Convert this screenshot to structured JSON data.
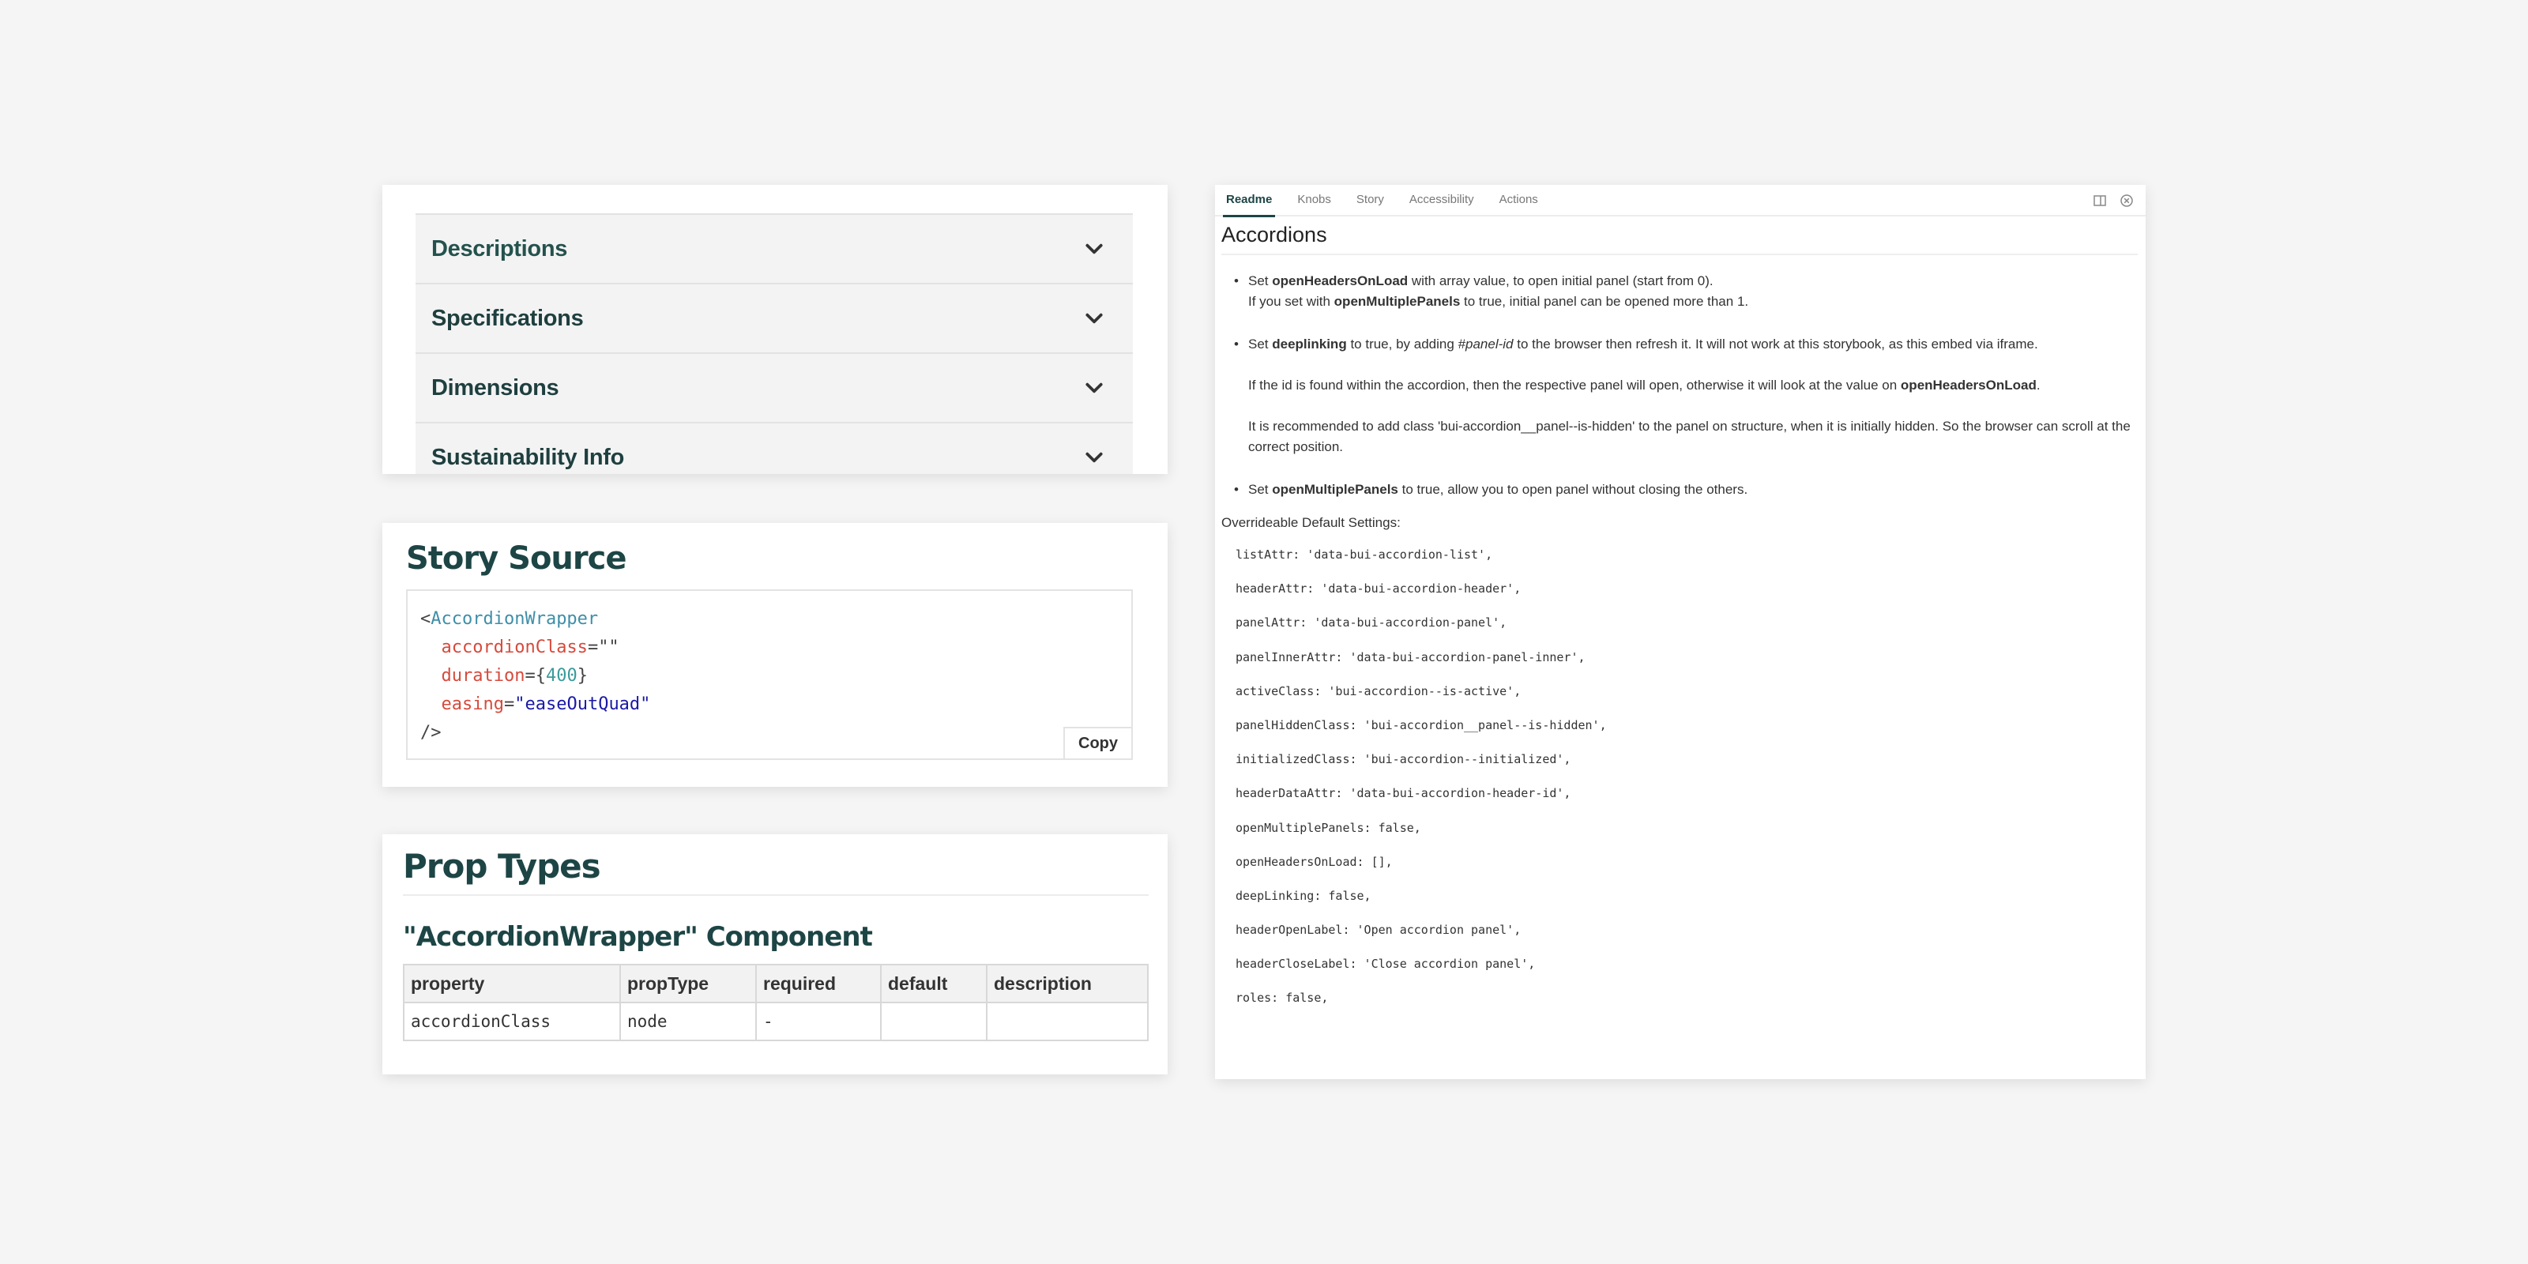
{
  "accordion": {
    "items": [
      {
        "title": "Descriptions"
      },
      {
        "title": "Specifications"
      },
      {
        "title": "Dimensions"
      },
      {
        "title": "Sustainability Info"
      }
    ]
  },
  "story_source": {
    "title": "Story Source",
    "code": {
      "open": "<",
      "tag": "AccordionWrapper",
      "attr1_name": "accordionClass",
      "attr1_eq": "=",
      "attr1_value": "\"\"",
      "attr2_name": "duration",
      "attr2_open": "={",
      "attr2_value": "400",
      "attr2_close": "}",
      "attr3_name": "easing",
      "attr3_eq": "=",
      "attr3_value": "\"easeOutQuad\"",
      "close": "/>"
    },
    "copy_label": "Copy"
  },
  "prop_types": {
    "title": "Prop Types",
    "component_title": "\"AccordionWrapper\" Component",
    "headers": [
      "property",
      "propType",
      "required",
      "default",
      "description"
    ],
    "rows": [
      [
        "accordionClass",
        "node",
        "-",
        "",
        ""
      ]
    ]
  },
  "readme": {
    "tabs": [
      "Readme",
      "Knobs",
      "Story",
      "Accessibility",
      "Actions"
    ],
    "heading": "Accordions",
    "b1_pre": "Set ",
    "b1_strong": "openHeadersOnLoad",
    "b1_post": " with array value, to open initial panel (start from 0).",
    "b1_l2_pre": "If you set with ",
    "b1_l2_strong": "openMultiplePanels",
    "b1_l2_post": " to true, initial panel can be opened more than 1.",
    "b2_pre": "Set ",
    "b2_strong": "deeplinking",
    "b2_mid": " to true, by adding ",
    "b2_em": "#panel-id",
    "b2_post": " to the browser then refresh it. It will not work at this storybook, as this embed via iframe.",
    "b2_p2_pre": "If the id is found within the accordion, then the respective panel will open, otherwise it will look at the value on ",
    "b2_p2_strong": "openHeadersOnLoad",
    "b2_p2_post": ".",
    "b2_p3": "It is recommended to add class 'bui-accordion__panel--is-hidden' to the panel on structure, when it is initially hidden. So the browser can scroll at the correct position.",
    "b3_pre": "Set ",
    "b3_strong": "openMultiplePanels",
    "b3_post": " to true, allow you to open panel without closing the others.",
    "settings_label": "Overrideable Default Settings:",
    "settings": [
      "listAttr: 'data-bui-accordion-list',",
      "headerAttr: 'data-bui-accordion-header',",
      "panelAttr: 'data-bui-accordion-panel',",
      "panelInnerAttr: 'data-bui-accordion-panel-inner',",
      "activeClass: 'bui-accordion--is-active',",
      "panelHiddenClass: 'bui-accordion__panel--is-hidden',",
      "initializedClass: 'bui-accordion--initialized',",
      "headerDataAttr: 'data-bui-accordion-header-id',",
      "openMultiplePanels: false,",
      "openHeadersOnLoad: [],",
      "deepLinking: false,",
      "headerOpenLabel: 'Open accordion panel',",
      "headerCloseLabel: 'Close accordion panel',",
      "roles: false,"
    ]
  },
  "colors": {
    "heading": "#1d4545",
    "code_tag": "#3f8ea8",
    "code_attr": "#d64a3c",
    "code_string": "#1a1aa6"
  },
  "icons": [
    "chevron-down-icon",
    "sidebar-toggle-icon",
    "close-circle-icon"
  ]
}
